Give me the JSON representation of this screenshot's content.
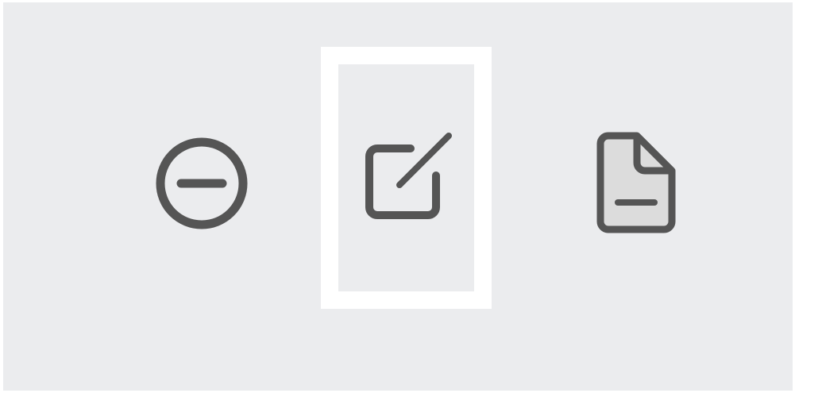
{
  "toolbar": {
    "background": "#ebecee",
    "icon_color": "#555555",
    "focus_color": "#ffffff",
    "buttons": [
      {
        "icon": "minus-circle-icon",
        "state": "normal"
      },
      {
        "icon": "edit-square-icon",
        "state": "focused"
      },
      {
        "icon": "document-icon",
        "state": "normal"
      }
    ]
  }
}
